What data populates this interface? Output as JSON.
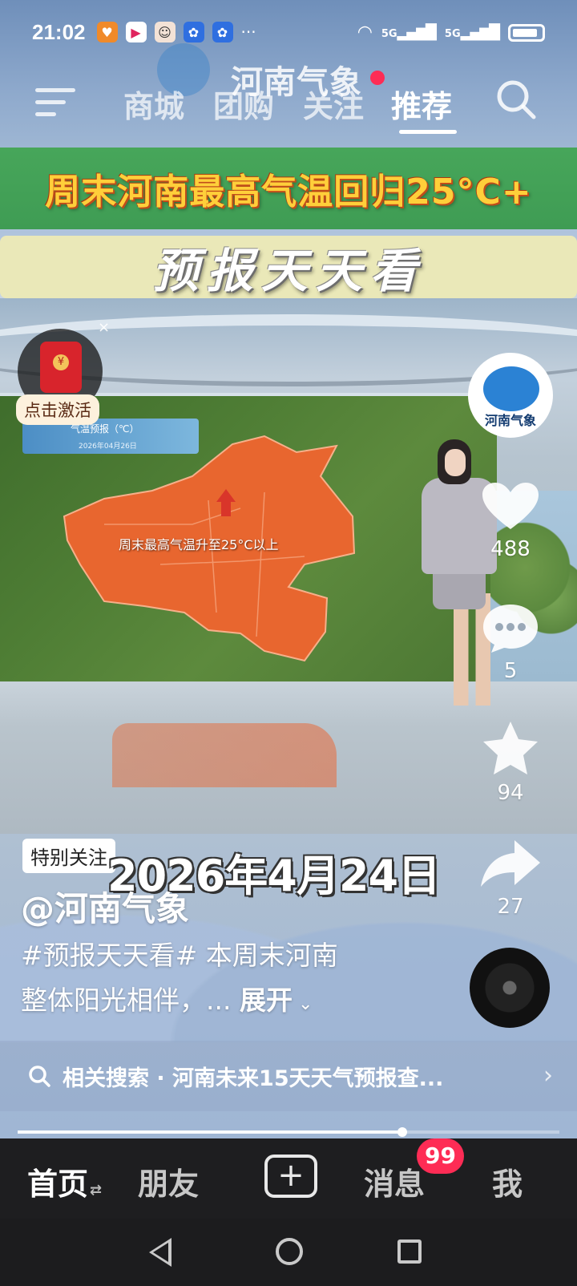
{
  "status_bar": {
    "time": "21:02",
    "more": "···",
    "net1": "5G",
    "net2": "5G",
    "app_icons": [
      "heart-badge-icon",
      "video-app-icon",
      "avatar-app-icon",
      "blue-app-icon",
      "blue-app-icon-2"
    ]
  },
  "top_nav": {
    "tabs": [
      "商城",
      "团购",
      "关注",
      "推荐"
    ],
    "active_tab": "推荐",
    "watermark": "河南气象"
  },
  "video": {
    "headline": "周末河南最高气温回归25°C+",
    "subheadline": "预报天天看",
    "screen_title": "气温预报（℃）",
    "screen_date": "2026年04月26日",
    "map_caption": "周末最高气温升至25°C以上",
    "overlay_date": "2026年4月24日"
  },
  "red_packet": {
    "label": "点击激活",
    "close": "×"
  },
  "actions": {
    "avatar_caption": "河南气象",
    "likes": "488",
    "comments": "5",
    "favorites": "94",
    "shares": "27"
  },
  "caption": {
    "tag": "特别关注",
    "author": "@河南气象",
    "description_line1": "#预报天天看# 本周末河南",
    "description_line2": "整体阳光相伴，... ",
    "expand": "展开"
  },
  "related_search": {
    "text": "相关搜索 · 河南未来15天天气预报查..."
  },
  "progress": {
    "fraction": 0.71
  },
  "bottom_nav": {
    "home": "首页",
    "friends": "朋友",
    "messages": "消息",
    "message_badge": "99",
    "me": "我",
    "plus": "+"
  },
  "colors": {
    "accent": "#fe2c55",
    "headline_green": "#47a65a",
    "headline_text": "#ffcf3a",
    "map_orange": "#e8662f"
  }
}
